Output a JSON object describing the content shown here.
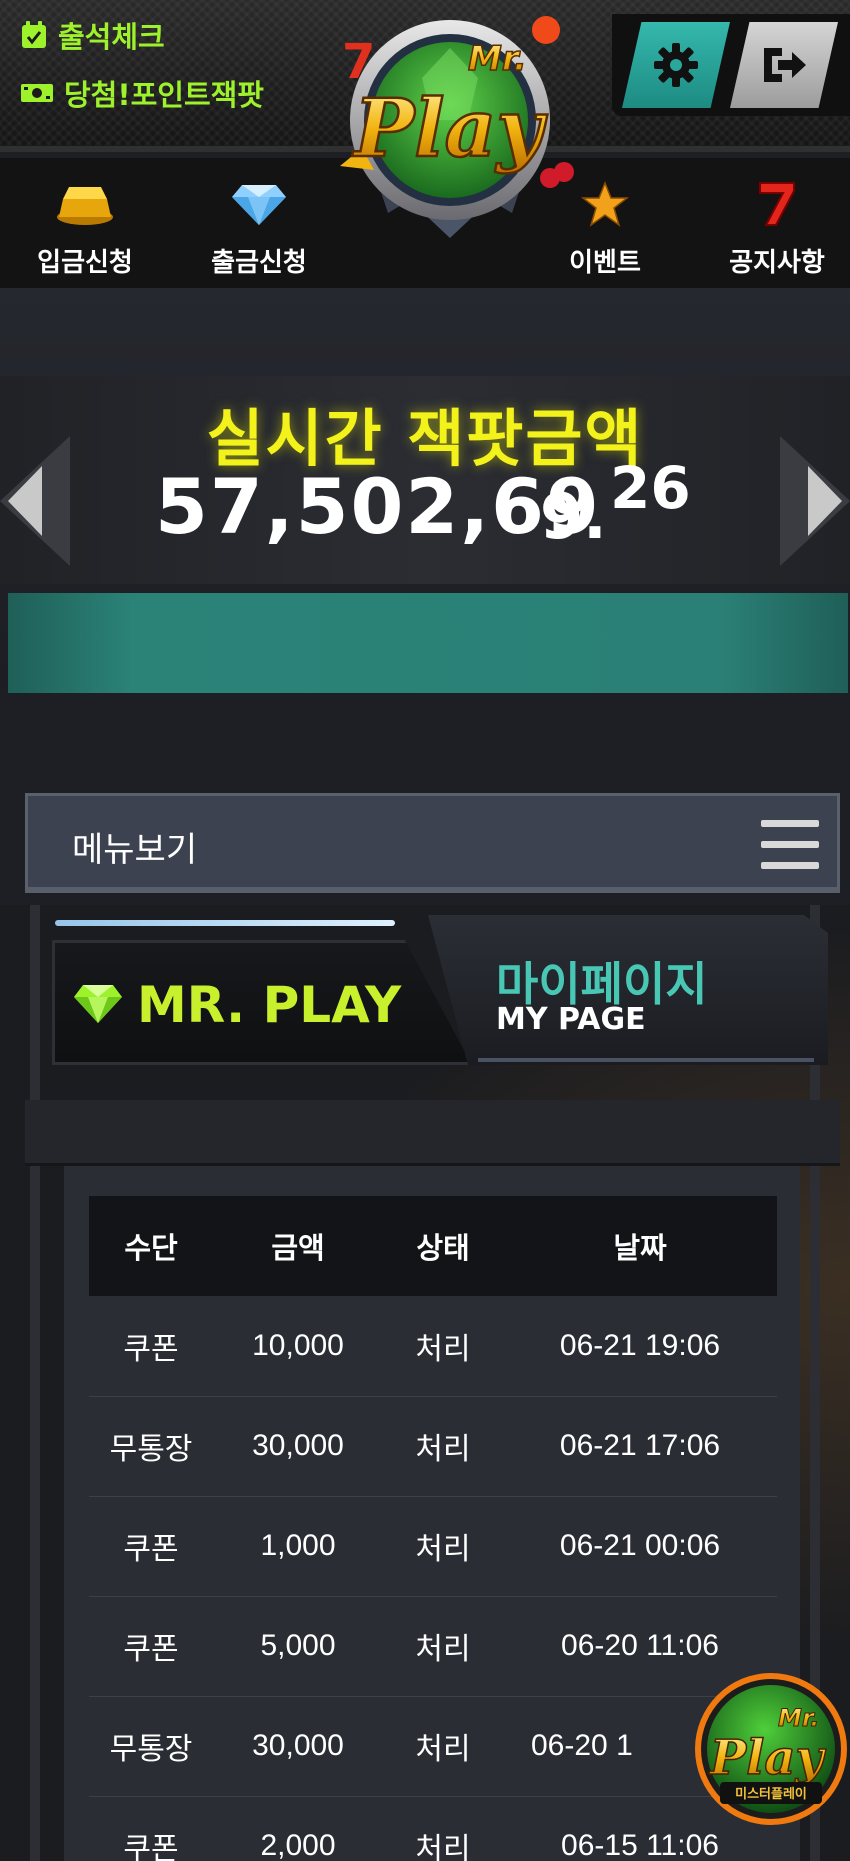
{
  "header": {
    "attendance_label": "출석체크",
    "jackpot_points_label": "당첨!포인트잭팟",
    "logo_text": "Play",
    "logo_prefix": "Mr.",
    "settings_icon": "gear-icon",
    "logout_icon": "logout-icon"
  },
  "nav": {
    "items": [
      {
        "label": "입금신청",
        "icon": "gold-bar-icon"
      },
      {
        "label": "출금신청",
        "icon": "diamond-icon"
      },
      {
        "label": "이벤트",
        "icon": "star-icon"
      },
      {
        "label": "공지사항",
        "icon": "lucky-seven-icon"
      }
    ]
  },
  "jackpot": {
    "title": "실시간 잭팟금액",
    "amount": "57,502,69",
    "rolling_digit": "9.",
    "rolling_next": "26"
  },
  "menu": {
    "label": "메뉴보기"
  },
  "mypage": {
    "brand": "MR. PLAY",
    "title_kr": "마이페이지",
    "title_en": "MY PAGE"
  },
  "table": {
    "headers": [
      "수단",
      "금액",
      "상태",
      "날짜"
    ],
    "rows": [
      [
        "쿠폰",
        "10,000",
        "처리",
        "06-21 19:06"
      ],
      [
        "무통장",
        "30,000",
        "처리",
        "06-21 17:06"
      ],
      [
        "쿠폰",
        "1,000",
        "처리",
        "06-21 00:06"
      ],
      [
        "쿠폰",
        "5,000",
        "처리",
        "06-20 11:06"
      ],
      [
        "무통장",
        "30,000",
        "처리",
        "06-20 1"
      ],
      [
        "쿠폰",
        "2,000",
        "처리",
        "06-15 11:06"
      ]
    ]
  },
  "floating_badge": {
    "line1": "Mr.",
    "line2": "Play",
    "caption": "미스터플레이"
  },
  "colors": {
    "accent_green": "#9ef22b",
    "jackpot_yellow": "#f3f21b",
    "teal": "#2b8378",
    "brand_lime": "#c9f02d",
    "title_teal": "#49c7b5"
  }
}
